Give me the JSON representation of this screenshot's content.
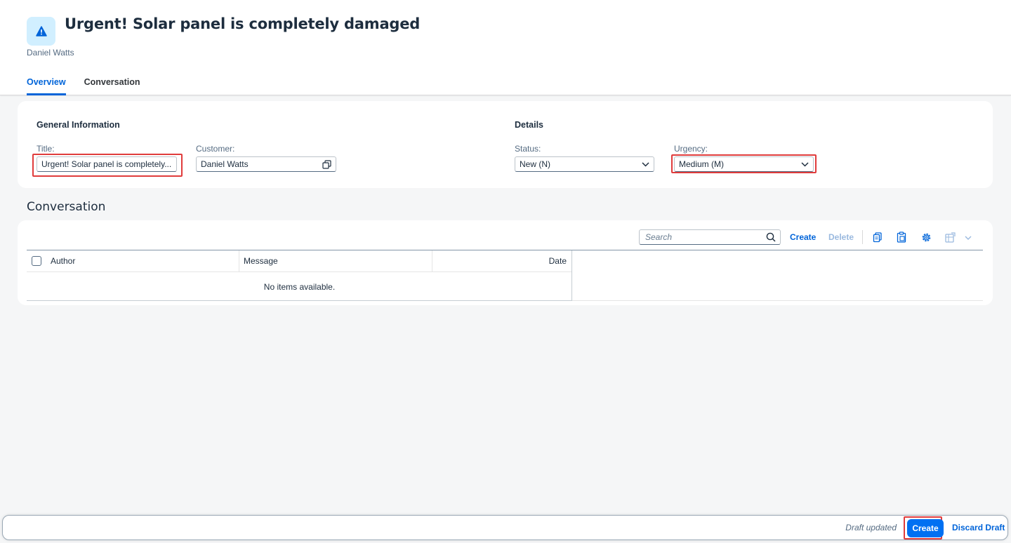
{
  "header": {
    "title": "Urgent! Solar panel is completely damaged",
    "subtitle": "Daniel Watts",
    "icon": "alert-icon",
    "accent": "#0064d9"
  },
  "tabs": [
    {
      "label": "Overview",
      "active": true
    },
    {
      "label": "Conversation",
      "active": false
    }
  ],
  "general": {
    "section_title": "General Information",
    "title_label": "Title:",
    "title_value": "Urgent! Solar panel is completely...",
    "customer_label": "Customer:",
    "customer_value": "Daniel Watts"
  },
  "details": {
    "section_title": "Details",
    "status_label": "Status:",
    "status_value": "New (N)",
    "urgency_label": "Urgency:",
    "urgency_value": "Medium (M)"
  },
  "conversation": {
    "title": "Conversation",
    "search_placeholder": "Search",
    "create_label": "Create",
    "delete_label": "Delete",
    "columns": [
      "Author",
      "Message",
      "Date"
    ],
    "empty_text": "No items available."
  },
  "footer": {
    "status": "Draft updated",
    "create_label": "Create",
    "discard_label": "Discard Draft"
  }
}
